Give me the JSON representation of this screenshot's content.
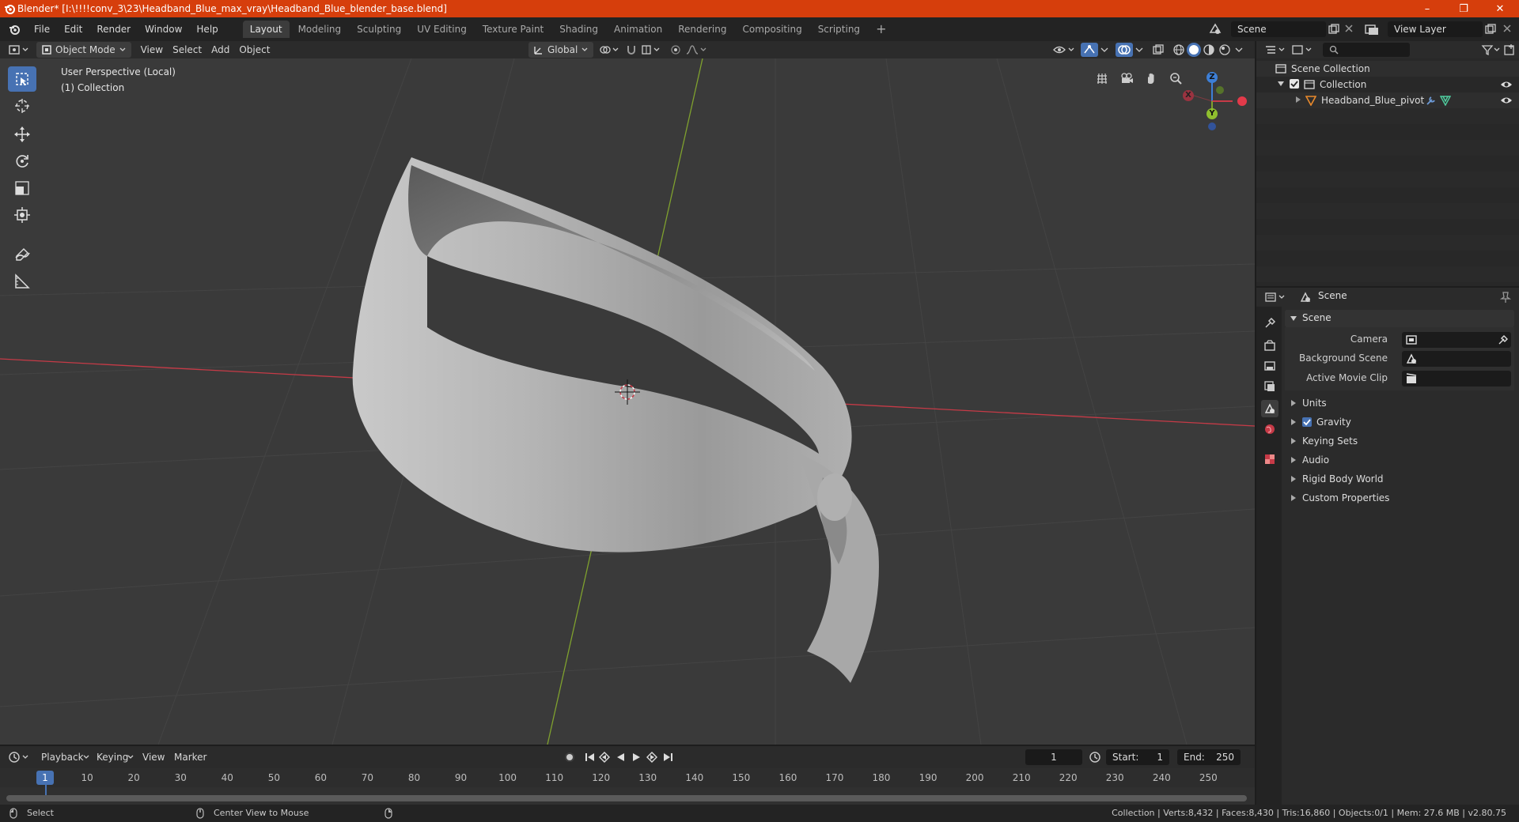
{
  "window": {
    "title": "Blender* [I:\\!!!!conv_3\\23\\Headband_Blue_max_vray\\Headband_Blue_blender_base.blend]",
    "minimize": "–",
    "maximize": "❐",
    "close": "✕"
  },
  "menu": [
    "File",
    "Edit",
    "Render",
    "Window",
    "Help"
  ],
  "workspaces": [
    "Layout",
    "Modeling",
    "Sculpting",
    "UV Editing",
    "Texture Paint",
    "Shading",
    "Animation",
    "Rendering",
    "Compositing",
    "Scripting"
  ],
  "workspace_add": "+",
  "scene_field": "Scene",
  "view_layer_field": "View Layer",
  "viewport_header": {
    "mode": "Object Mode",
    "menus": [
      "View",
      "Select",
      "Add",
      "Object"
    ],
    "transform_orientation": "Global"
  },
  "viewport": {
    "perspective_label": "User Perspective (Local)",
    "collection_label": "(1) Collection",
    "gizmo": {
      "x": "X",
      "y": "Y",
      "z": "Z"
    }
  },
  "outliner": {
    "root": "Scene Collection",
    "collection": "Collection",
    "object": "Headband_Blue_pivot"
  },
  "properties": {
    "header": "Scene",
    "panel_title": "Scene",
    "camera_label": "Camera",
    "background_scene_label": "Background Scene",
    "active_movie_clip_label": "Active Movie Clip",
    "sections": [
      "Units",
      "Gravity",
      "Keying Sets",
      "Audio",
      "Rigid Body World",
      "Custom Properties"
    ],
    "gravity_checked": true
  },
  "timeline": {
    "menus": [
      "Playback",
      "Keying",
      "View",
      "Marker"
    ],
    "current_frame": "1",
    "start_label": "Start:",
    "start_value": "1",
    "end_label": "End:",
    "end_value": "250",
    "ruler_current": "1",
    "ticks": [
      "10",
      "20",
      "30",
      "40",
      "50",
      "60",
      "70",
      "80",
      "90",
      "100",
      "110",
      "120",
      "130",
      "140",
      "150",
      "160",
      "170",
      "180",
      "190",
      "200",
      "210",
      "220",
      "230",
      "240",
      "250"
    ]
  },
  "status": {
    "left_action": "Select",
    "middle_action": "Center View to Mouse",
    "stats": "Collection | Verts:8,432 | Faces:8,430 | Tris:16,860 | Objects:0/1 | Mem: 27.6 MB | v2.80.75"
  },
  "colors": {
    "title_bar": "#d63e0c",
    "active_tool": "#4772b3",
    "x_axis": "#c63a47",
    "y_axis": "#7fa12e",
    "z_axis": "#3d7fd6",
    "current_frame": "#4772b3"
  }
}
